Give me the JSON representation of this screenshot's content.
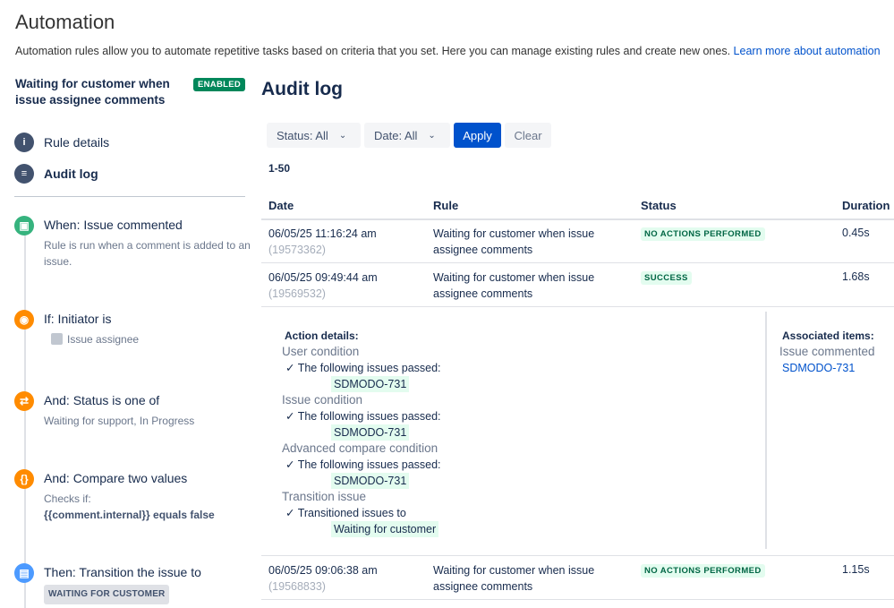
{
  "header": {
    "title": "Automation",
    "description": "Automation rules allow you to automate repetitive tasks based on criteria that you set. Here you can manage existing rules and create new ones.",
    "learn_more": "Learn more about automation"
  },
  "sidebar": {
    "rule_name": "Waiting for customer when issue assignee comments",
    "badge": "ENABLED",
    "nav": [
      {
        "label": "Rule details",
        "icon": "info-icon"
      },
      {
        "label": "Audit log",
        "icon": "list-icon"
      }
    ],
    "steps": [
      {
        "title": "When: Issue commented",
        "sub": "Rule is run when a comment is added to an issue.",
        "icon": "comment-icon",
        "color": "#36b37e"
      },
      {
        "title": "If: Initiator is",
        "sub": "Issue assignee",
        "icon": "user-icon",
        "color": "#ff8b00"
      },
      {
        "title": "And: Status is one of",
        "sub": "Waiting for support, In Progress",
        "icon": "shuffle-icon",
        "color": "#ff8b00"
      },
      {
        "title": "And: Compare two values",
        "sub": "Checks if:",
        "sub2": "{{comment.internal}} equals false",
        "icon": "braces-icon",
        "color": "#ff8b00"
      },
      {
        "title": "Then: Transition the issue to",
        "lozenge": "WAITING FOR CUSTOMER",
        "icon": "transition-icon",
        "color": "#4c9aff"
      }
    ]
  },
  "main": {
    "title": "Audit log",
    "filters": {
      "status": "Status: All",
      "date": "Date: All",
      "apply": "Apply",
      "clear": "Clear"
    },
    "range": "1-50",
    "columns": [
      "Date",
      "Rule",
      "Status",
      "Duration"
    ],
    "rows": [
      {
        "date": "06/05/25 11:16:24 am",
        "id": "(19573362)",
        "rule": "Waiting for customer when issue assignee comments",
        "status": "NO ACTIONS PERFORMED",
        "duration": "0.45s"
      },
      {
        "date": "06/05/25 09:49:44 am",
        "id": "(19569532)",
        "rule": "Waiting for customer when issue assignee comments",
        "status": "SUCCESS",
        "duration": "1.68s"
      },
      {
        "date": "06/05/25 09:06:38 am",
        "id": "(19568833)",
        "rule": "Waiting for customer when issue assignee comments",
        "status": "NO ACTIONS PERFORMED",
        "duration": "1.15s"
      }
    ],
    "details": {
      "header": "Action details:",
      "blocks": [
        {
          "title": "User condition",
          "line": "✓ The following issues passed:",
          "chip": "SDMODO-731"
        },
        {
          "title": "Issue condition",
          "line": "✓ The following issues passed:",
          "chip": "SDMODO-731"
        },
        {
          "title": "Advanced compare condition",
          "line": "✓ The following issues passed:",
          "chip": "SDMODO-731"
        },
        {
          "title": "Transition issue",
          "line": "✓ Transitioned issues to",
          "chip": "Waiting for customer"
        }
      ],
      "associated_header": "Associated items:",
      "associated_label": "Issue commented",
      "associated_link": "SDMODO-731"
    }
  },
  "colors": {
    "accent": "#0052cc",
    "enabled": "#00875a",
    "success_bg": "#e3fcef",
    "success_text": "#006644"
  }
}
